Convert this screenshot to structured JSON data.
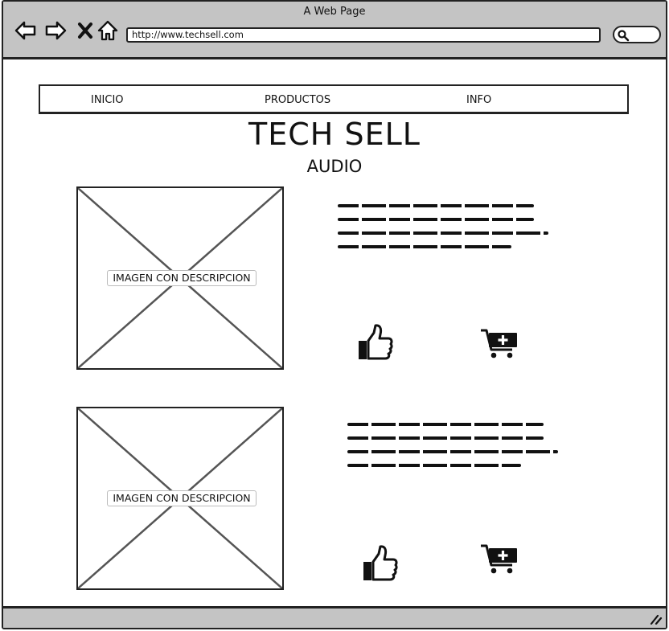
{
  "browser": {
    "title": "A Web Page",
    "url": "http://www.techsell.com",
    "icons": [
      "back-icon",
      "forward-icon",
      "close-icon",
      "home-icon",
      "search-icon"
    ]
  },
  "menu": {
    "items": [
      {
        "label": "INICIO"
      },
      {
        "label": "PRODUCTOS"
      },
      {
        "label": "INFO"
      }
    ]
  },
  "page": {
    "title": "TECH SELL",
    "section": "AUDIO"
  },
  "products": [
    {
      "image_caption": "IMAGEN CON DESCRIPCION"
    },
    {
      "image_caption": "IMAGEN CON DESCRIPCION"
    }
  ],
  "colors": {
    "chrome": "#c4c4c4",
    "ink": "#222222",
    "placeholder_cross": "#555555"
  }
}
